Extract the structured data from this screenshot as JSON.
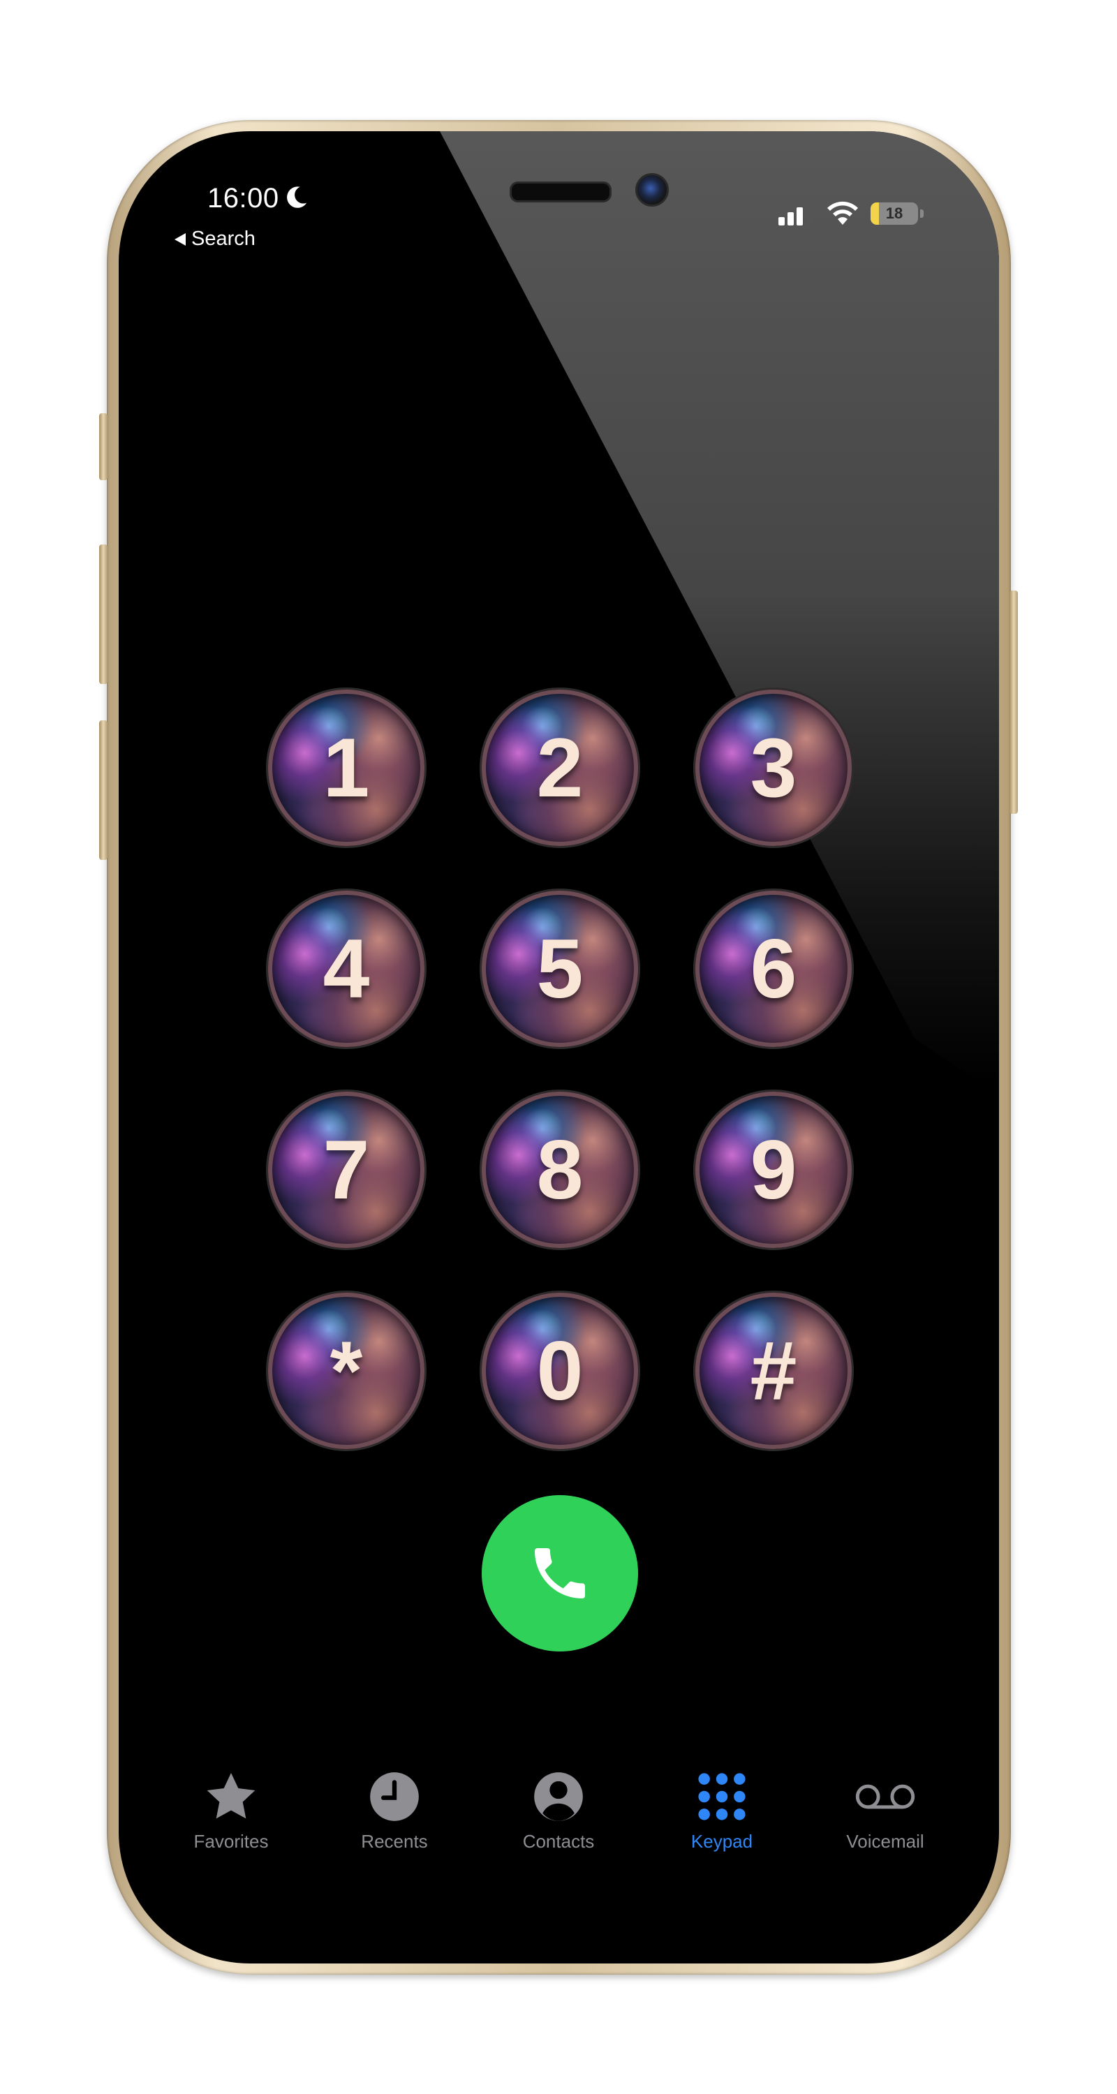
{
  "status_bar": {
    "time": "16:00",
    "back_label": "Search",
    "battery_level": "18",
    "battery_fraction": 0.18
  },
  "icons": {
    "moon": "moon-icon",
    "back": "back-triangle-icon",
    "signal": "cellular-signal-icon",
    "wifi": "wifi-icon",
    "battery": "battery-icon",
    "call": "phone-handset-icon"
  },
  "keypad": {
    "keys": [
      "1",
      "2",
      "3",
      "4",
      "5",
      "6",
      "7",
      "8",
      "9",
      "*",
      "0",
      "#"
    ]
  },
  "tabs": [
    {
      "label": "Favorites",
      "icon": "star-icon"
    },
    {
      "label": "Recents",
      "icon": "clock-icon"
    },
    {
      "label": "Contacts",
      "icon": "person-circle-icon"
    },
    {
      "label": "Keypad",
      "icon": "keypad-grid-icon"
    },
    {
      "label": "Voicemail",
      "icon": "voicemail-icon"
    }
  ],
  "active_tab": "Keypad",
  "colors": {
    "call_green": "#30d158",
    "active_tab_blue": "#2f86f6",
    "inactive_tab_gray": "#8e8e93",
    "battery_yellow": "#f3d34a",
    "key_label": "#fae6d6"
  }
}
